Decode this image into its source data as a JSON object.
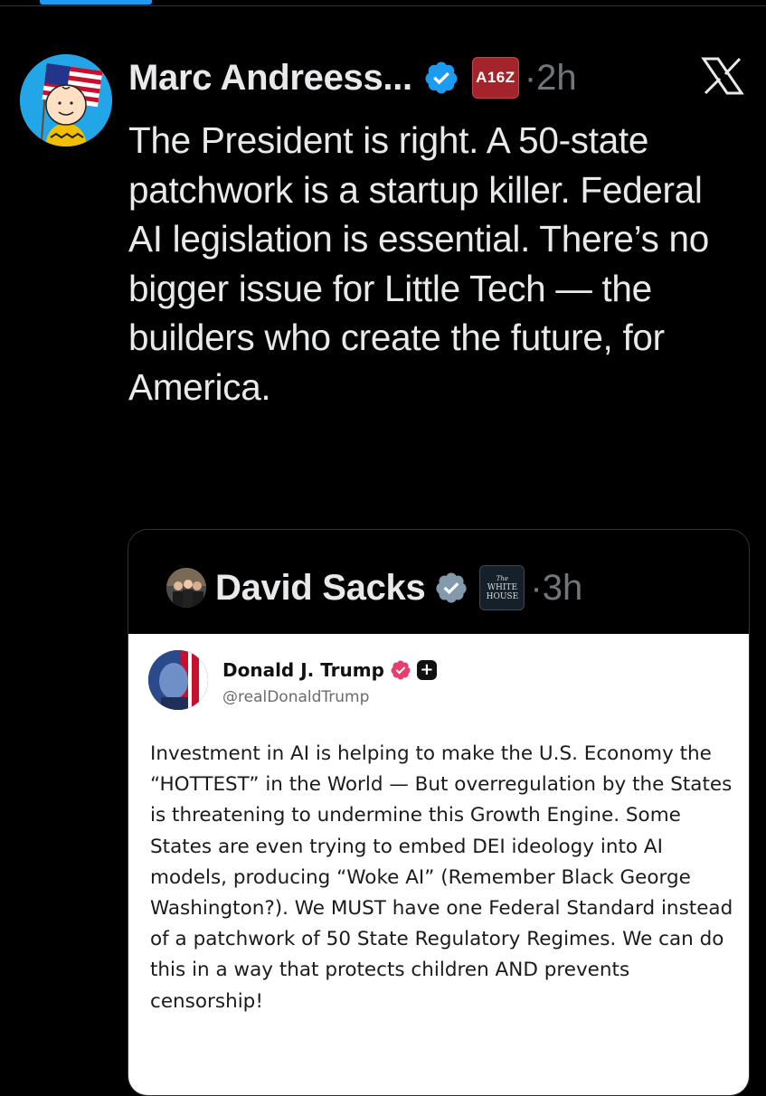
{
  "colors": {
    "background": "#000000",
    "accent": "#1d9bf0",
    "verified": "#1d9bf0",
    "affiliate_badge": "#a4242b",
    "truth_verified": "#e63e6d"
  },
  "main_tweet": {
    "author_name": "Marc Andreess...",
    "affiliation_badge": "A16Z",
    "time": "·2h",
    "avatar_icon": "charlie-brown-flag-avatar",
    "platform_icon": "x-logo",
    "text": "The President is right. A 50-state patchwork is a startup killer. Federal AI legislation is essential. There’s no bigger issue for Little Tech — the builders who create the future, for America."
  },
  "quoted_tweet": {
    "author_name": "David Sacks",
    "affiliation_badge_lines": [
      "The",
      "WHITE",
      "HOUSE"
    ],
    "time": "·3h",
    "avatar_icon": "group-photo-avatar",
    "embedded_post": {
      "author_name": "Donald J. Trump",
      "handle": "@realDonaldTrump",
      "avatar_icon": "portrait-flag-avatar",
      "badge_icon": "plus-badge-icon",
      "text": "Investment in AI is helping to make the U.S. Economy the “HOTTEST” in the World — But overregulation by the States is threatening to undermine this Growth Engine. Some States are even trying to embed DEI ideology into AI models, producing “Woke AI” (Remember Black George Washington?). We MUST have one Federal Standard instead of a patchwork of 50 State Regulatory Regimes. We can do this in a way that protects children AND prevents censorship!"
    }
  }
}
